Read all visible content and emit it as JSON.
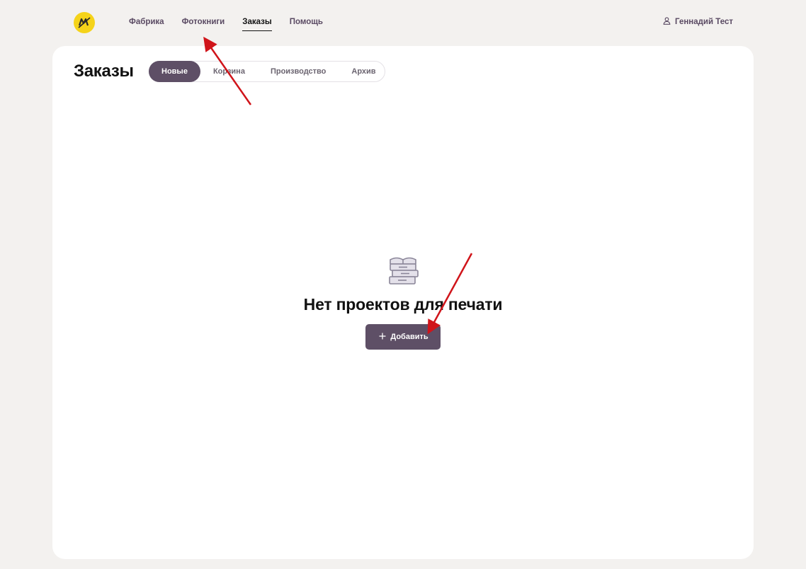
{
  "header": {
    "logo_icon": "brand-logo-icon",
    "nav": [
      {
        "label": "Фабрика"
      },
      {
        "label": "Фотокниги"
      },
      {
        "label": "Заказы",
        "active": true
      },
      {
        "label": "Помощь"
      }
    ],
    "user": {
      "icon": "user-icon",
      "name": "Геннадий Тест"
    }
  },
  "main": {
    "title": "Заказы",
    "tabs": [
      {
        "label": "Новые",
        "active": true
      },
      {
        "label": "Корзина"
      },
      {
        "label": "Производство"
      },
      {
        "label": "Архив"
      }
    ],
    "empty_state": {
      "icon": "stacked-books-icon",
      "title": "Нет проектов для печати",
      "add_button": {
        "icon": "plus-icon",
        "label": "Добавить"
      }
    }
  },
  "colors": {
    "background": "#f3f1ef",
    "card": "#ffffff",
    "accent": "#5e4f66",
    "logo": "#f5d31a",
    "annotation_arrow": "#d0141a"
  }
}
